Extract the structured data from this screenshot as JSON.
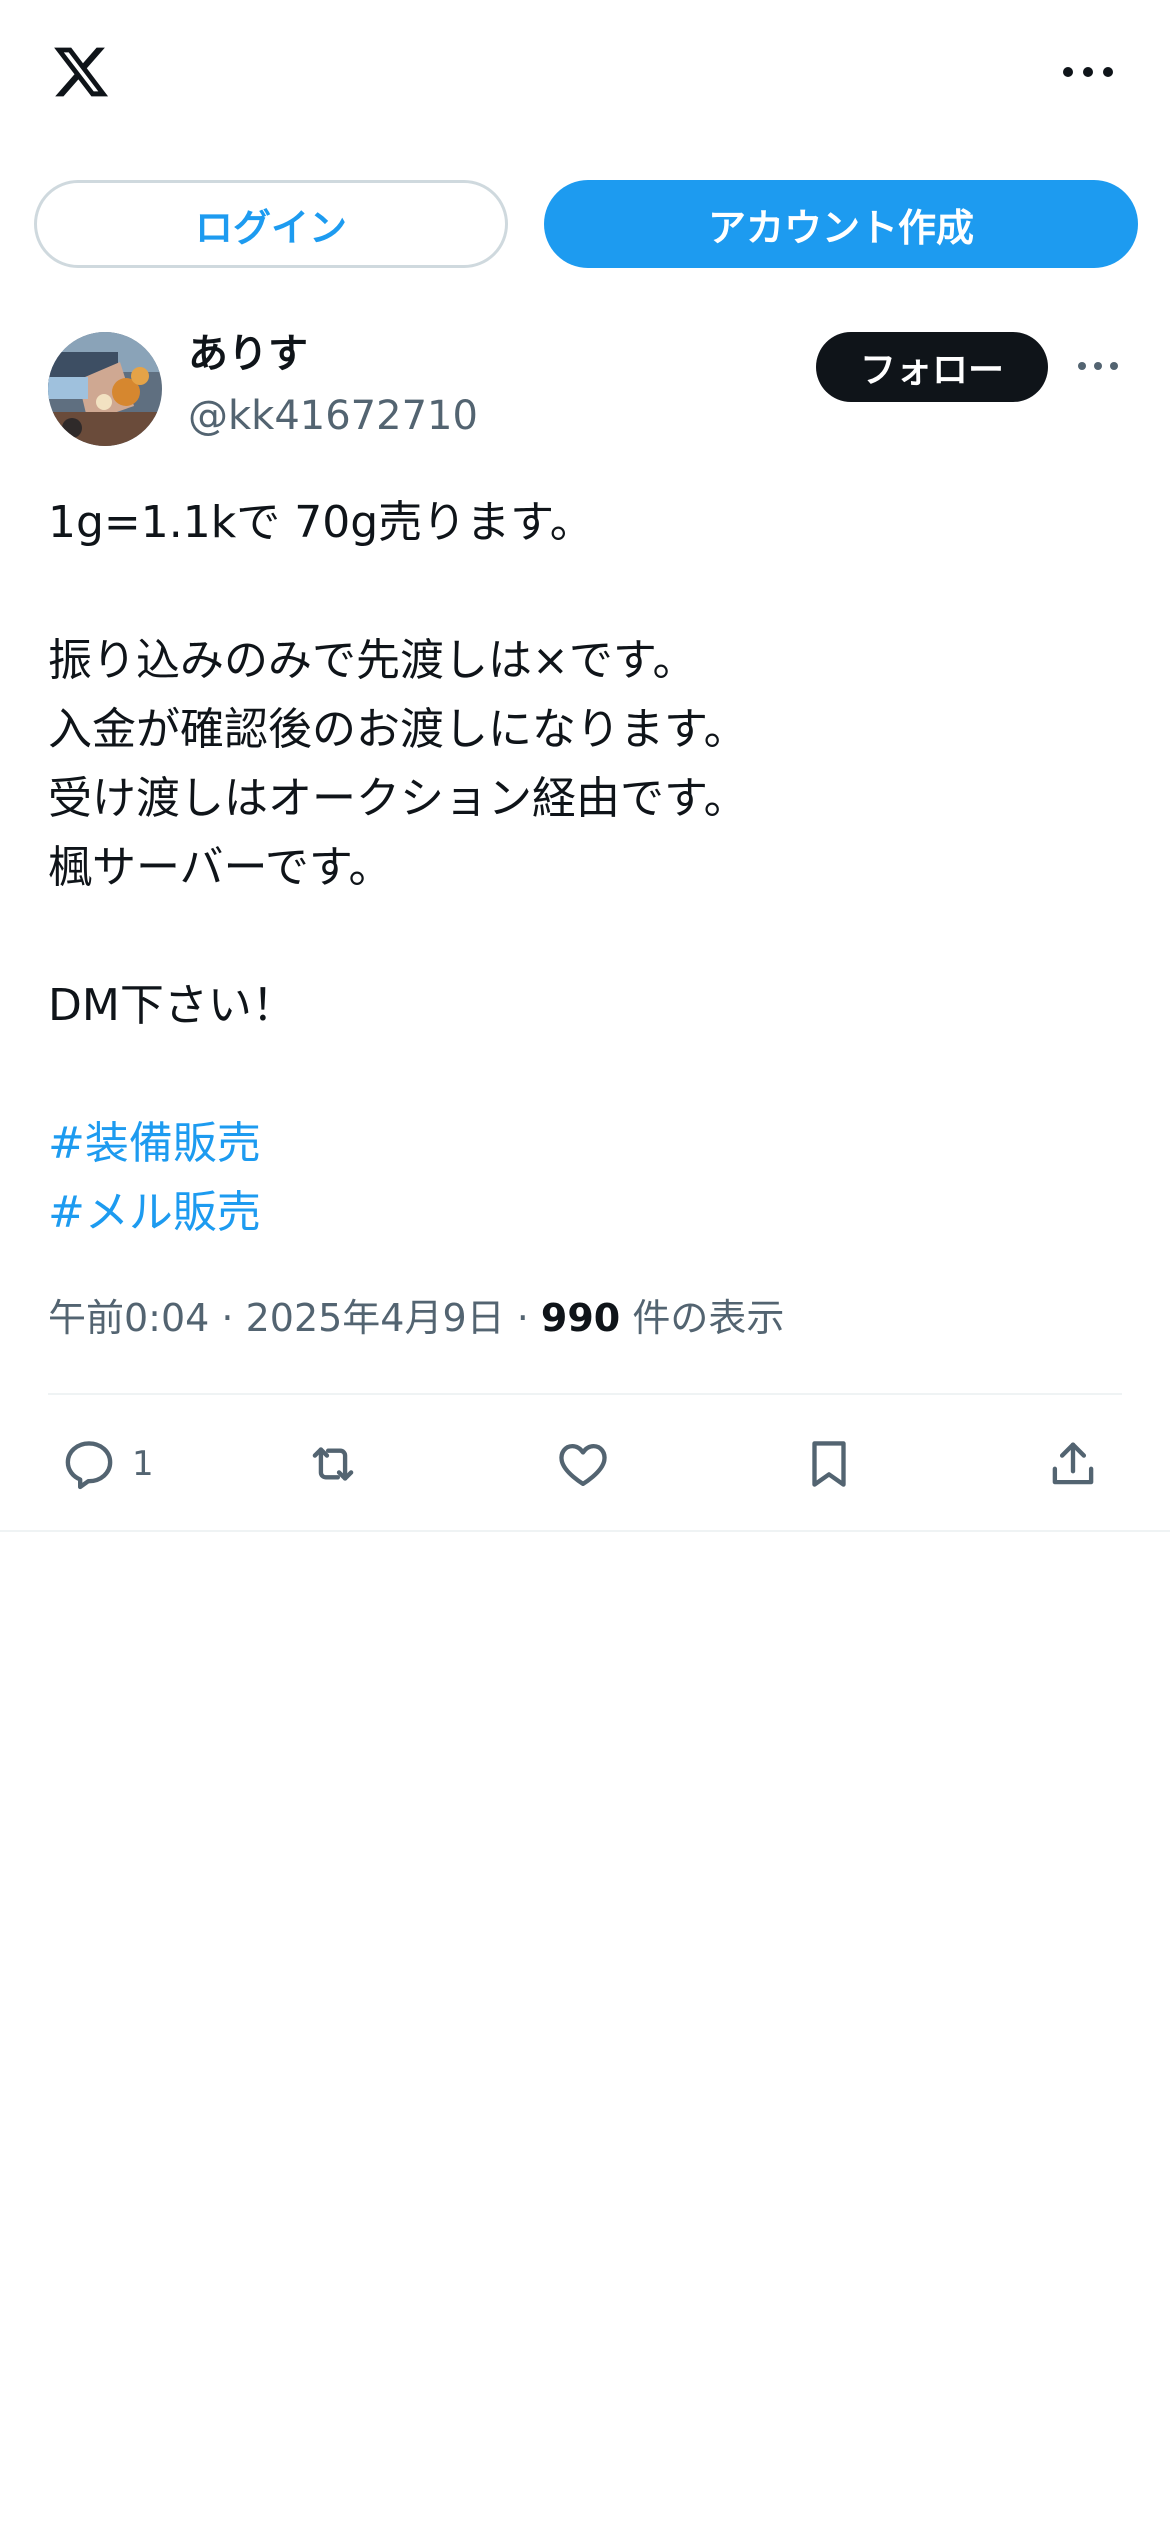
{
  "header": {
    "logo_icon": "x-logo-icon",
    "more_icon": "more-horizontal-icon"
  },
  "auth": {
    "login_label": "ログイン",
    "signup_label": "アカウント作成"
  },
  "tweet": {
    "author": {
      "display_name": "ありす",
      "handle": "@kk41672710"
    },
    "follow_label": "フォロー",
    "lines": [
      "1g=1.1kで 70g売ります。",
      "",
      "振り込みのみで先渡しは×です。",
      "入金が確認後のお渡しになります。",
      "受け渡しはオークション経由です。",
      "楓サーバーです。",
      "",
      "DM下さい！",
      ""
    ],
    "hashtags": [
      "#装備販売",
      "#メル販売"
    ],
    "time": "午前0:04",
    "sep1": " · ",
    "date": "2025年4月9日",
    "sep2": " · ",
    "views_count": "990",
    "views_label": " 件の表示",
    "actions": {
      "reply_count": "1"
    }
  },
  "colors": {
    "accent": "#1d9bf0",
    "text": "#0f1419",
    "secondary": "#536471",
    "border": "#cfd9de"
  }
}
